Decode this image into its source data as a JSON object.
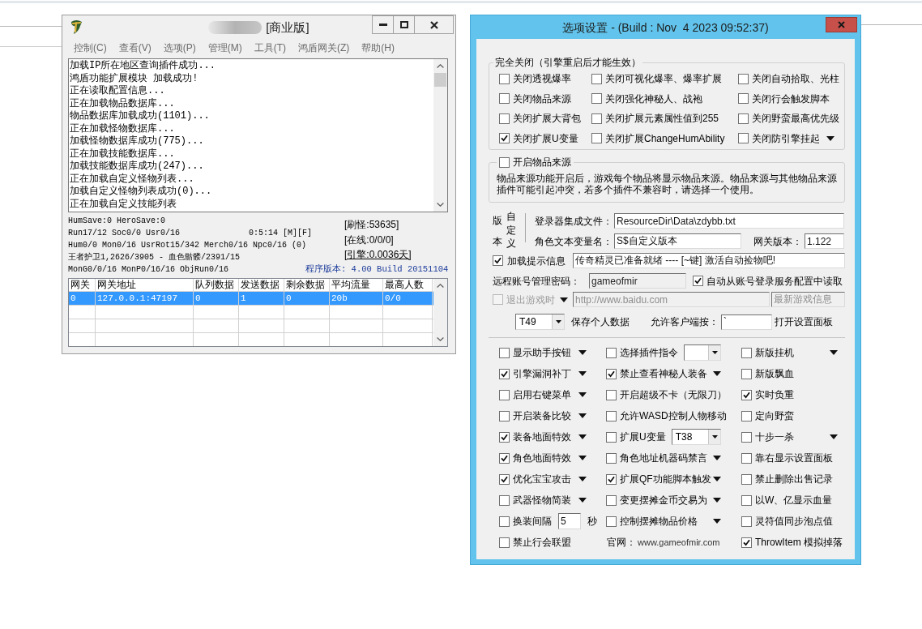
{
  "server_window": {
    "title": "[商业版]",
    "menu": [
      "控制(C)",
      "查看(V)",
      "选项(P)",
      "管理(M)",
      "工具(T)",
      "鸿盾网关(Z)",
      "帮助(H)"
    ],
    "log": [
      "加载IP所在地区查询插件成功...",
      "鸿盾功能扩展模块 加载成功!",
      "正在读取配置信息...",
      "正在加载物品数据库...",
      "物品数据库加载成功(1101)...",
      "正在加载怪物数据库...",
      "加载怪物数据库成功(775)...",
      "正在加载技能数据库...",
      "加载技能数据库成功(247)...",
      "正在加载自定义怪物列表...",
      "加载自定义怪物列表成功(0)...",
      "正在加载自定义技能列表"
    ],
    "status": {
      "lines": [
        {
          "text": "HumSave:0 HeroSave:0"
        },
        {
          "text": "Run17/12 Soc0/0 Usr0/16",
          "timer": "0:5:14 [M][F]"
        },
        {
          "text": "Hum0/0 Mon0/16 UsrRot15/342 Merch0/16 Npc0/16 (0)"
        },
        {
          "text": "王者护卫1,2626/3905 - 血色骷髅/2391/15"
        },
        {
          "text": "MonG0/0/16 MonP0/16/16 ObjRun0/16"
        }
      ],
      "refresh_count": "[刷怪:53635]",
      "online": "[在线:0/0/0]",
      "engine_time": "[引擎:0.0036天]",
      "version": "程序版本: 4.00 Build 20151104"
    },
    "gateway_table": {
      "columns": [
        "网关",
        "网关地址",
        "队列数据",
        "发送数据",
        "剩余数据",
        "平均流量",
        "最高人数"
      ],
      "rows": [
        {
          "cells": [
            "0",
            "127.0.0.1:47197",
            "0",
            "1",
            "0",
            "20b",
            "0/0"
          ],
          "selected": true
        }
      ]
    }
  },
  "options_window": {
    "title": "选项设置 - (Build : Nov  4 2023 09:52:37)",
    "disable_group": {
      "title": "完全关闭（引擎重启后才能生效）",
      "options": [
        {
          "label": "关闭透视爆率",
          "checked": false,
          "menu_arrow": false
        },
        {
          "label": "关闭可视化爆率、爆率扩展",
          "checked": false,
          "menu_arrow": false
        },
        {
          "label": "关闭自动拾取、光柱",
          "checked": false,
          "menu_arrow": false
        },
        {
          "label": "关闭物品来源",
          "checked": false,
          "menu_arrow": false
        },
        {
          "label": "关闭强化神秘人、战袍",
          "checked": false,
          "menu_arrow": false
        },
        {
          "label": "关闭行会触发脚本",
          "checked": false,
          "menu_arrow": false
        },
        {
          "label": "关闭扩展大背包",
          "checked": false,
          "menu_arrow": false
        },
        {
          "label": "关闭扩展元素属性值到255",
          "checked": false,
          "menu_arrow": false
        },
        {
          "label": "关闭野蛮最高优先级",
          "checked": false,
          "menu_arrow": false
        },
        {
          "label": "关闭扩展U变量",
          "checked": true,
          "menu_arrow": false
        },
        {
          "label": "关闭扩展ChangeHumAbility",
          "checked": false,
          "menu_arrow": false
        },
        {
          "label": "关闭防引擎挂起",
          "checked": false,
          "menu_arrow": true
        }
      ]
    },
    "item_source": {
      "label": "开启物品来源",
      "checked": false,
      "description": "物品来源功能开启后，游戏每个物品将显示物品来源。物品来源与其他物品来源插件可能引起冲突，若多个插件不兼容时，请选择一个使用。"
    },
    "custom_version": {
      "side_labels": [
        "版本",
        "自定义"
      ],
      "launcher_file": {
        "label": "登录器集成文件：",
        "value": "ResourceDir\\Data\\zdybb.txt"
      },
      "role_variable": {
        "label": "角色文本变量名：",
        "value": "S$自定义版本"
      },
      "gateway_version": {
        "label": "网关版本：",
        "value": "1.122"
      }
    },
    "load_message": {
      "label": "加载提示信息",
      "checked": true,
      "value": "传奇精灵已准备就绪 ---- [~键] 激活自动捡物吧!"
    },
    "remote_password": {
      "label": "远程账号管理密码：",
      "value": "gameofmir",
      "read_only": true,
      "auto_read": {
        "label": "自动从账号登录服务配置中读取",
        "checked": true
      }
    },
    "exit_row": {
      "label": "退出游戏时",
      "checked": false,
      "disabled": true,
      "url": "http://www.baidu.com",
      "info": "最新游戏信息"
    },
    "save_row": {
      "combo_value": "T49",
      "label": "保存个人数据",
      "key_label": "允许客户端按：",
      "key_value": "`",
      "key_action": "打开设置面板"
    },
    "options": [
      {
        "kind": "checkbox",
        "label": "显示助手按钮",
        "checked": false,
        "menu_arrow": true
      },
      {
        "kind": "combo",
        "label": "选择插件指令",
        "checked": false
      },
      {
        "kind": "checkbox",
        "label": "新版挂机",
        "checked": false,
        "menu_arrow": true
      },
      {
        "kind": "checkbox",
        "label": "引擎漏洞补丁",
        "checked": true,
        "menu_arrow": true
      },
      {
        "kind": "checkbox",
        "label": "禁止查看神秘人装备",
        "checked": true,
        "menu_arrow": true
      },
      {
        "kind": "checkbox",
        "label": "新版飘血",
        "checked": false,
        "menu_arrow": false
      },
      {
        "kind": "checkbox",
        "label": "启用右键菜单",
        "checked": false,
        "menu_arrow": true
      },
      {
        "kind": "checkbox",
        "label": "开启超级不卡（无限刀）",
        "checked": false,
        "menu_arrow": false
      },
      {
        "kind": "checkbox",
        "label": "实时负重",
        "checked": true,
        "menu_arrow": false
      },
      {
        "kind": "checkbox",
        "label": "开启装备比较",
        "checked": false,
        "menu_arrow": true
      },
      {
        "kind": "checkbox",
        "label": "允许WASD控制人物移动",
        "checked": false,
        "menu_arrow": false
      },
      {
        "kind": "checkbox",
        "label": "定向野蛮",
        "checked": false,
        "menu_arrow": false
      },
      {
        "kind": "checkbox",
        "label": "装备地面特效",
        "checked": true,
        "menu_arrow": true
      },
      {
        "kind": "combo",
        "label": "扩展U变量",
        "checked": false,
        "value": "T38"
      },
      {
        "kind": "checkbox",
        "label": "十步一杀",
        "checked": false,
        "menu_arrow": true
      },
      {
        "kind": "checkbox",
        "label": "角色地面特效",
        "checked": true,
        "menu_arrow": true
      },
      {
        "kind": "checkbox",
        "label": "角色地址机器码禁言",
        "checked": false,
        "menu_arrow": true
      },
      {
        "kind": "checkbox",
        "label": "靠右显示设置面板",
        "checked": false,
        "menu_arrow": false
      },
      {
        "kind": "checkbox",
        "label": "优化宝宝攻击",
        "checked": true,
        "menu_arrow": true
      },
      {
        "kind": "checkbox",
        "label": "扩展QF功能脚本触发",
        "checked": true,
        "menu_arrow": true
      },
      {
        "kind": "checkbox",
        "label": "禁止删除出售记录",
        "checked": false,
        "menu_arrow": false
      },
      {
        "kind": "checkbox",
        "label": "武器怪物简装",
        "checked": false,
        "menu_arrow": true
      },
      {
        "kind": "checkbox",
        "label": "变更摆摊金币交易为",
        "checked": false,
        "menu_arrow": true
      },
      {
        "kind": "checkbox",
        "label": "以W、亿显示血量",
        "checked": false,
        "menu_arrow": false
      },
      {
        "kind": "number",
        "label": "换装间隔",
        "checked": false,
        "value": "5",
        "unit": "秒"
      },
      {
        "kind": "checkbox",
        "label": "控制摆摊物品价格",
        "checked": false,
        "menu_arrow": true
      },
      {
        "kind": "checkbox",
        "label": "灵符值同步泡点值",
        "checked": false,
        "menu_arrow": false
      },
      {
        "kind": "checkbox",
        "label": "禁止行会联盟",
        "checked": false,
        "menu_arrow": false
      },
      {
        "kind": "link",
        "label": "官网：",
        "value": "www.gameofmir.com"
      },
      {
        "kind": "checkbox",
        "label": "ThrowItem 模拟掉落",
        "checked": true,
        "menu_arrow": false
      }
    ]
  }
}
